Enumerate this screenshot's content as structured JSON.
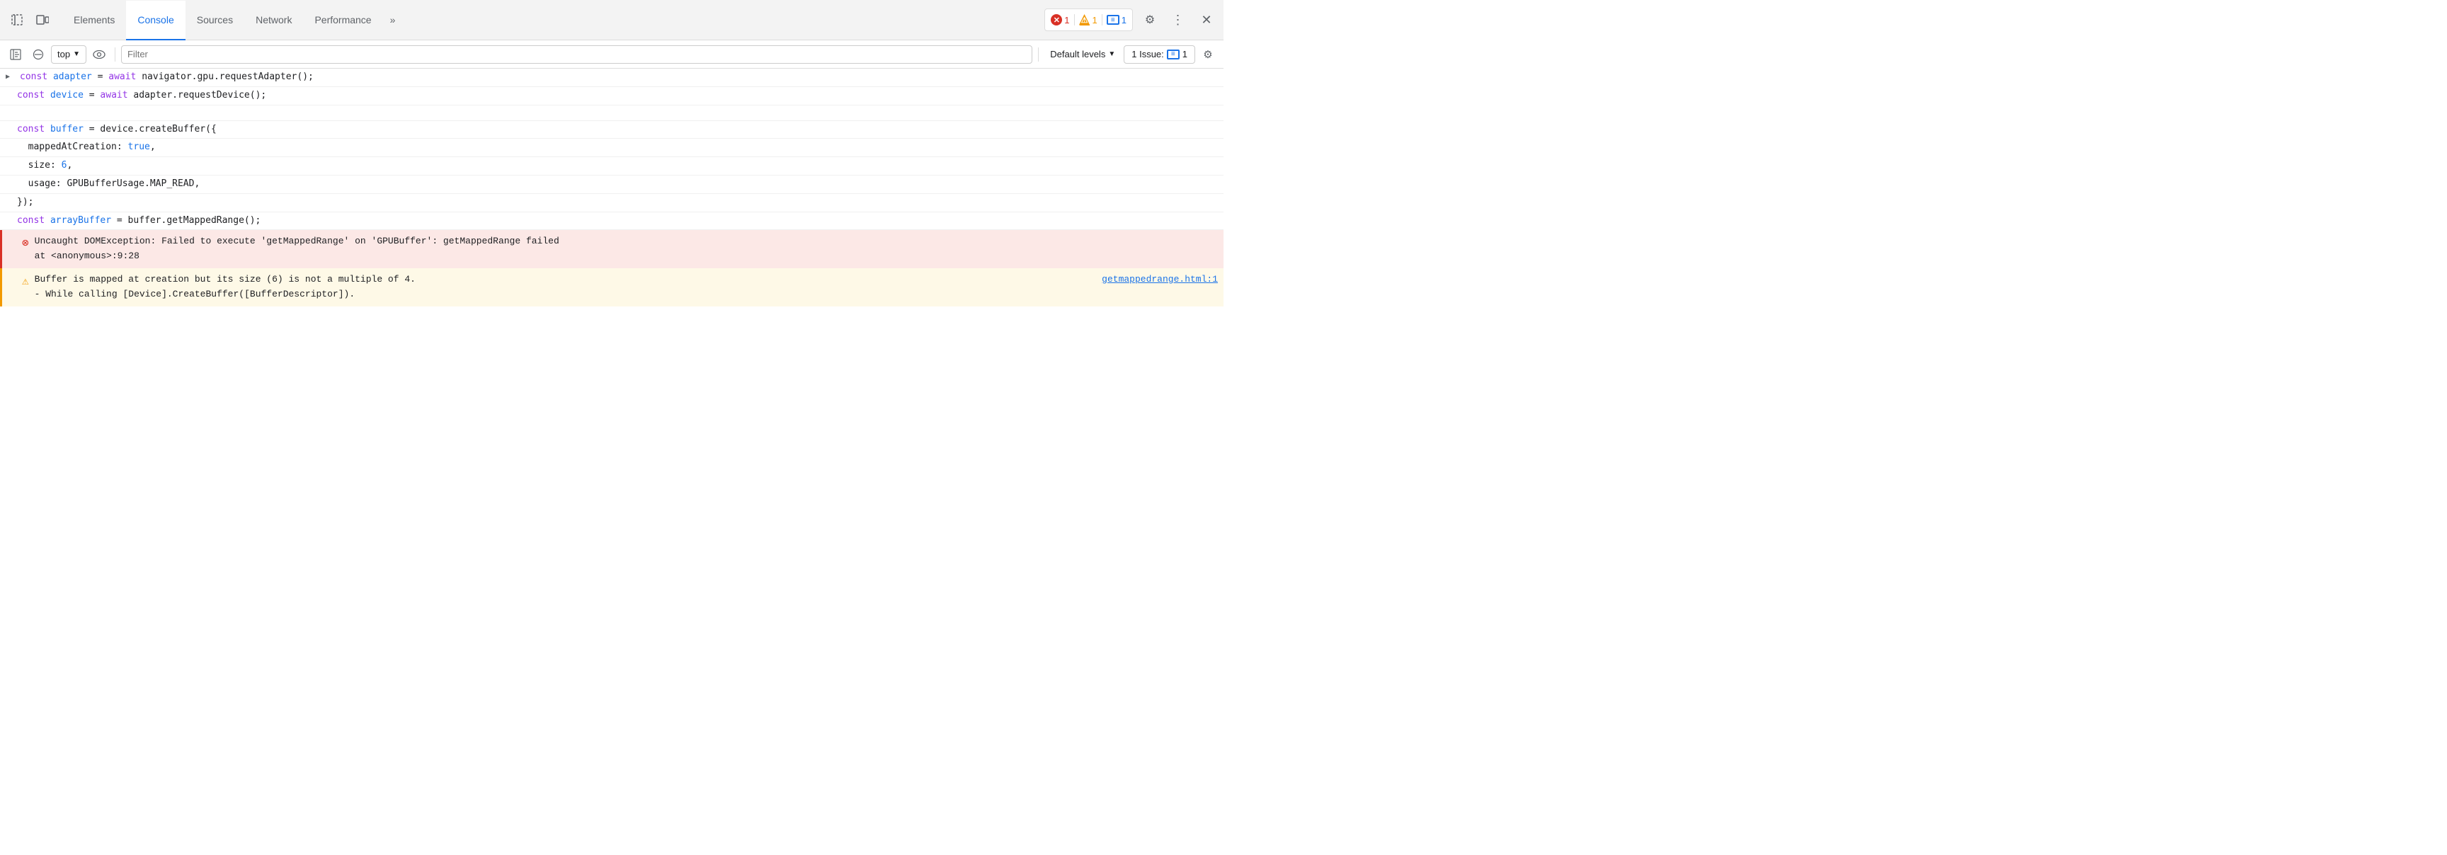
{
  "tabs": {
    "items": [
      {
        "label": "Elements",
        "active": false
      },
      {
        "label": "Console",
        "active": true
      },
      {
        "label": "Sources",
        "active": false
      },
      {
        "label": "Network",
        "active": false
      },
      {
        "label": "Performance",
        "active": false
      }
    ],
    "more_label": "»"
  },
  "badges": {
    "error_count": "1",
    "warning_count": "1",
    "message_count": "1"
  },
  "toolbar": {
    "top_label": "top",
    "filter_placeholder": "Filter",
    "default_levels_label": "Default levels",
    "issues_label": "1 Issue:",
    "issues_count": "1"
  },
  "console": {
    "lines": [
      {
        "type": "code",
        "expandable": true,
        "content": "const adapter = await navigator.gpu.requestAdapter();"
      },
      {
        "type": "code",
        "expandable": false,
        "indent": true,
        "content": "const device = await adapter.requestDevice();"
      },
      {
        "type": "blank"
      },
      {
        "type": "code",
        "expandable": false,
        "indent": true,
        "content": "const buffer = device.createBuffer({"
      },
      {
        "type": "code",
        "expandable": false,
        "indent": true,
        "content": "  mappedAtCreation: true,"
      },
      {
        "type": "code",
        "expandable": false,
        "indent": true,
        "content": "  size: 6,"
      },
      {
        "type": "code",
        "expandable": false,
        "indent": true,
        "content": "  usage: GPUBufferUsage.MAP_READ,"
      },
      {
        "type": "code",
        "expandable": false,
        "indent": true,
        "content": "});"
      },
      {
        "type": "code",
        "expandable": false,
        "indent": true,
        "content": "const arrayBuffer = buffer.getMappedRange();"
      }
    ],
    "error": {
      "main": "Uncaught DOMException: Failed to execute 'getMappedRange' on 'GPUBuffer': getMappedRange failed",
      "sub": "    at <anonymous>:9:28"
    },
    "warning": {
      "main": "Buffer is mapped at creation but its size (6) is not a multiple of 4.",
      "sub": "  - While calling [Device].CreateBuffer([BufferDescriptor]).",
      "link_text": "getmappedrange.html:1"
    }
  }
}
